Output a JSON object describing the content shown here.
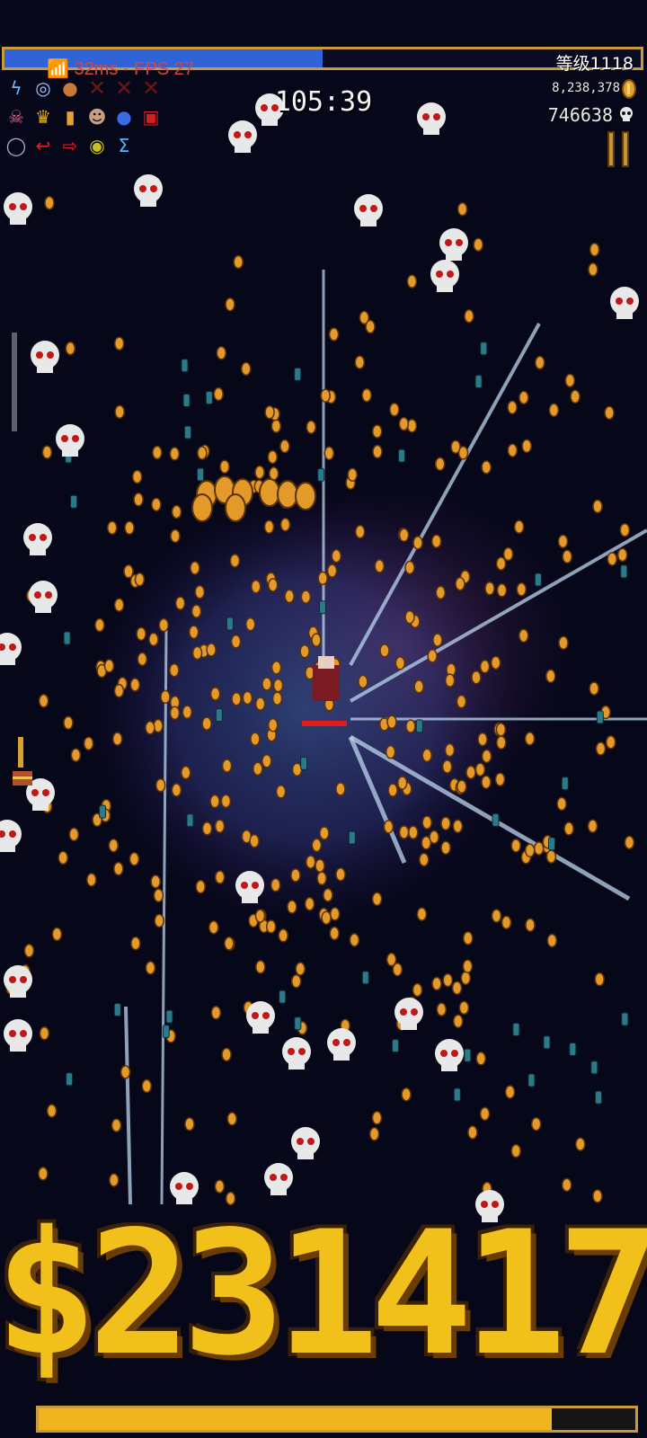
{
  "hud": {
    "ping_text": "📶 32ms · FPS 27",
    "timer": "105:39",
    "level_text": "等级1118",
    "gold_text": "8,238,378",
    "kills_text": "746638",
    "xp_fraction": 0.5,
    "bottom_bar_fraction": 0.86,
    "big_number": "$231417"
  },
  "weapon_slots": [
    [
      "lightning-icon",
      "orb-icon",
      "meat-icon",
      "empty",
      "empty",
      "empty"
    ],
    [
      "skull-ring-icon",
      "crown-icon",
      "candle-icon",
      "face-icon",
      "blue-orb-icon",
      "red-tome-icon"
    ],
    [
      "ring-icon",
      "red-arrow-icon",
      "red-attractor-icon",
      "gold-ring-icon",
      "sigma-icon"
    ]
  ],
  "colors": {
    "xp": "#3062d8",
    "gold": "#f2c01a",
    "frame": "#c79a3c",
    "ping": "#e0423a"
  }
}
